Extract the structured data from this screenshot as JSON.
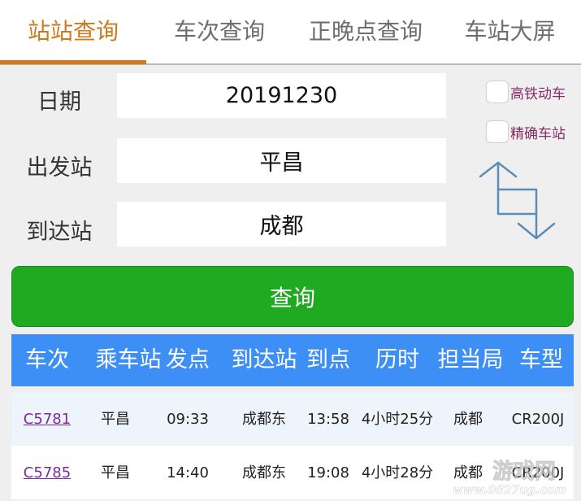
{
  "tabs": [
    {
      "label": "站站查询",
      "active": true
    },
    {
      "label": "车次查询",
      "active": false
    },
    {
      "label": "正晚点查询",
      "active": false
    },
    {
      "label": "车站大屏",
      "active": false
    }
  ],
  "form": {
    "date_label": "日期",
    "date_value": "20191230",
    "from_label": "出发站",
    "from_value": "平昌",
    "to_label": "到达站",
    "to_value": "成都",
    "options": [
      {
        "label": "高铁动车",
        "checked": false
      },
      {
        "label": "精确车站",
        "checked": false
      }
    ],
    "query_label": "查询"
  },
  "table": {
    "headers": [
      "车次",
      "乘车站",
      "发点",
      "到达站",
      "到点",
      "历时",
      "担当局",
      "车型"
    ],
    "rows": [
      [
        "C5781",
        "平昌",
        "09:33",
        "成都东",
        "13:58",
        "4小时25分",
        "成都",
        "CR200J"
      ],
      [
        "C5785",
        "平昌",
        "14:40",
        "成都东",
        "19:08",
        "4小时28分",
        "成都",
        "CR200J"
      ]
    ]
  },
  "watermark": {
    "line1": "游戏网",
    "line2": "www.0827ug.com"
  },
  "colors": {
    "accent": "#cc7a1c",
    "query_button": "#1faa22",
    "table_header": "#3d8ef5",
    "link": "#7b2a9c",
    "checkbox_label": "#8a2a64",
    "swap_arrows": "#5b8db8"
  },
  "icons": {
    "swap": "swap-arrows-icon"
  }
}
